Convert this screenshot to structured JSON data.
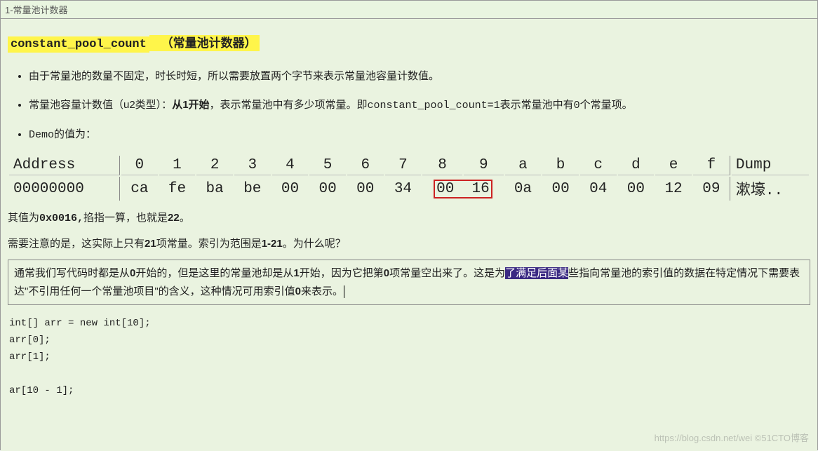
{
  "tab": {
    "label": "1-常量池计数器"
  },
  "title": {
    "code": "constant_pool_count",
    "gap": " ",
    "paren": "（常量池计数器）"
  },
  "bullets": {
    "b1": "由于常量池的数量不固定，时长时短，所以需要放置两个字节来表示常量池容量计数值。",
    "b2_pre": "常量池容量计数值（u2类型）：",
    "b2_bold": "从1开始",
    "b2_mid": "，表示常量池中有多少项常量。即",
    "b2_code1": "constant_pool_count=1",
    "b2_mid2": "表示常量池中有",
    "b2_code2": "0",
    "b2_end": "个常量项。",
    "b3_pre": "Demo",
    "b3_end": "的值为："
  },
  "hex": {
    "header": [
      "Address",
      "0",
      "1",
      "2",
      "3",
      "4",
      "5",
      "6",
      "7",
      "8",
      "9",
      "a",
      "b",
      "c",
      "d",
      "e",
      "f",
      "Dump"
    ],
    "row0": {
      "addr": "00000000",
      "cells": [
        "ca",
        "fe",
        "ba",
        "be",
        "00",
        "00",
        "00",
        "34",
        "00",
        "16",
        "0a",
        "00",
        "04",
        "00",
        "12",
        "09"
      ],
      "dump": "漱壕..",
      "boxStart": 8,
      "boxEnd": 9
    }
  },
  "p1": {
    "pre": "其值为",
    "code": "0x0016,",
    "mid": "掐指一算，也就是",
    "bold": "22",
    "end": "。"
  },
  "p2": {
    "pre": "需要注意的是，这实际上只有",
    "bold1": "21",
    "mid": "项常量。索引为范围是",
    "bold2": "1-21",
    "end": "。为什么呢？"
  },
  "note": {
    "pre": "通常我们写代码时都是从",
    "b0": "0",
    "m1": "开始的，但是这里的常量池却是从",
    "b1": "1",
    "m2": "开始，因为它把第",
    "b0b": "0",
    "m3": "项常量空出来了。这是为",
    "selected": "了满足后面某",
    "m4": "些指向常量池的索引值的数据在特定情况下需要表达\"不引用任何一个常量池项目\"的含义，这种情况可用索引值",
    "b0c": "0",
    "end": "来表示。"
  },
  "code": {
    "l1": "int[] arr = new int[10];",
    "l2": "arr[0];",
    "l3": "arr[1];",
    "l4": "ar[10 - 1];"
  },
  "watermark": "https://blog.csdn.net/wei  ©51CTO博客"
}
